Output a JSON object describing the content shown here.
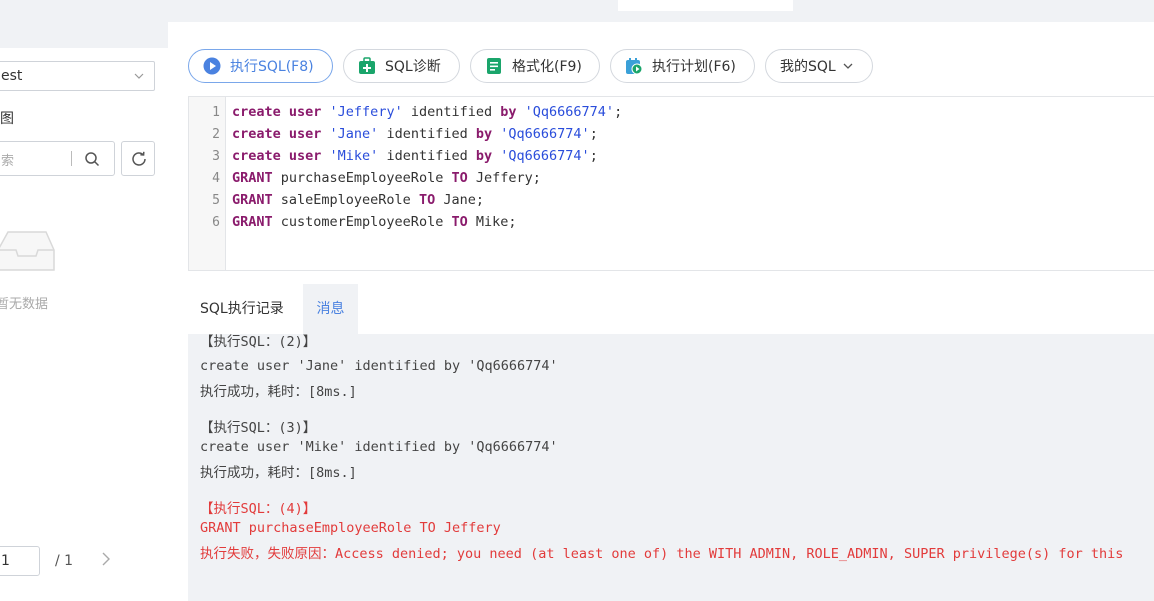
{
  "sidebar": {
    "db_selected": "est",
    "section_title": "图",
    "search_placeholder": "索",
    "empty_text": "暂无数据",
    "pager_current": "1",
    "pager_total": "/ 1"
  },
  "toolbar": {
    "execute_label": "执行SQL(F8)",
    "diagnose_label": "SQL诊断",
    "format_label": "格式化(F9)",
    "plan_label": "执行计划(F6)",
    "my_sql_label": "我的SQL"
  },
  "editor": {
    "line_numbers": [
      "1",
      "2",
      "3",
      "4",
      "5",
      "6"
    ],
    "lines": [
      [
        {
          "t": "create user ",
          "c": "kw"
        },
        {
          "t": "'Jeffery'",
          "c": "str"
        },
        {
          "t": " identified ",
          "c": ""
        },
        {
          "t": "by",
          "c": "kw"
        },
        {
          "t": " ",
          "c": ""
        },
        {
          "t": "'Qq6666774'",
          "c": "str"
        },
        {
          "t": ";",
          "c": ""
        }
      ],
      [
        {
          "t": "create user ",
          "c": "kw"
        },
        {
          "t": "'Jane'",
          "c": "str"
        },
        {
          "t": " identified ",
          "c": ""
        },
        {
          "t": "by",
          "c": "kw"
        },
        {
          "t": " ",
          "c": ""
        },
        {
          "t": "'Qq6666774'",
          "c": "str"
        },
        {
          "t": ";",
          "c": ""
        }
      ],
      [
        {
          "t": "create user ",
          "c": "kw"
        },
        {
          "t": "'Mike'",
          "c": "str"
        },
        {
          "t": " identified ",
          "c": ""
        },
        {
          "t": "by",
          "c": "kw"
        },
        {
          "t": " ",
          "c": ""
        },
        {
          "t": "'Qq6666774'",
          "c": "str"
        },
        {
          "t": ";",
          "c": ""
        }
      ],
      [
        {
          "t": "GRANT",
          "c": "kw"
        },
        {
          "t": " purchaseEmployeeRole ",
          "c": ""
        },
        {
          "t": "TO",
          "c": "kw"
        },
        {
          "t": " Jeffery;",
          "c": ""
        }
      ],
      [
        {
          "t": "GRANT",
          "c": "kw"
        },
        {
          "t": " saleEmployeeRole ",
          "c": ""
        },
        {
          "t": "TO",
          "c": "kw"
        },
        {
          "t": " Jane;",
          "c": ""
        }
      ],
      [
        {
          "t": "GRANT",
          "c": "kw"
        },
        {
          "t": " customerEmployeeRole ",
          "c": ""
        },
        {
          "t": "TO",
          "c": "kw"
        },
        {
          "t": " Mike;",
          "c": ""
        }
      ]
    ]
  },
  "result_tabs": {
    "history": "SQL执行记录",
    "messages": "消息"
  },
  "messages": {
    "partial_header": "【执行SQL：(2)】",
    "m2_sql": "create user 'Jane' identified by 'Qq6666774'",
    "m2_result": "执行成功，耗时：[8ms.]",
    "m3_header": "【执行SQL：(3)】",
    "m3_sql": "create user 'Mike' identified by 'Qq6666774'",
    "m3_result": "执行成功，耗时：[8ms.]",
    "m4_header": "【执行SQL：(4)】",
    "m4_sql": "GRANT purchaseEmployeeRole TO Jeffery",
    "m4_result": "执行失败，失败原因：Access denied; you need (at least one of) the WITH ADMIN, ROLE_ADMIN, SUPER privilege(s) for this"
  },
  "colors": {
    "accent": "#4a82e0",
    "keyword": "#8a1b6c",
    "string": "#2a4ddb",
    "error": "#e23b3b",
    "panel_bg": "#f0f2f5"
  }
}
